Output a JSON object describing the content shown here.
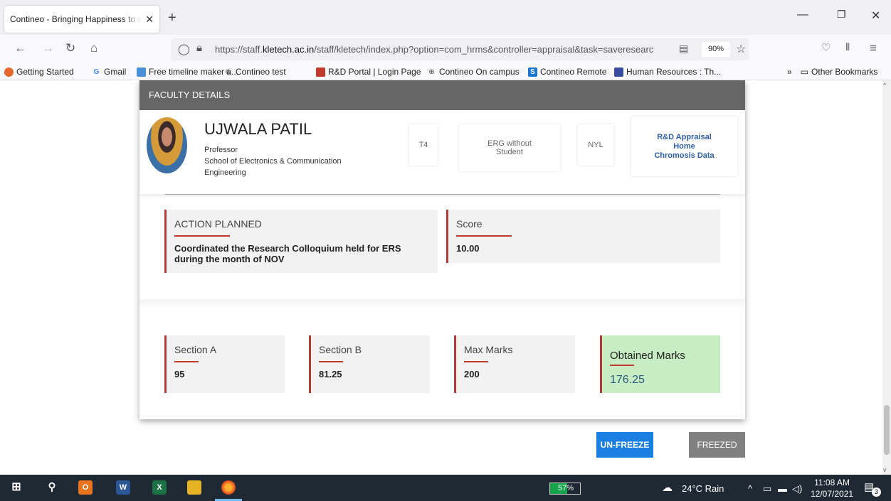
{
  "browser": {
    "tab_title": "Contineo - Bringing Happiness to w",
    "url_host": "https://staff.",
    "url_domain": "kletech.ac.in",
    "url_path": "/staff/kletech/index.php?option=com_hrms&controller=appraisal&task=saveresearc",
    "zoom": "90%",
    "bookmarks": [
      "Getting Started",
      "Gmail",
      "Free timeline maker a...",
      "Contineo test",
      "R&D Portal | Login Page",
      "Contineo On campus",
      "Contineo Remote",
      "Human Resources : Th..."
    ],
    "other_bookmarks": "Other Bookmarks"
  },
  "page": {
    "header": "FACULTY DETAILS",
    "faculty": {
      "name": "UJWALA PATIL",
      "designation": "Professor",
      "school": "School of Electronics & Communication Engineering"
    },
    "tags": {
      "grade": "T4",
      "category": "ERG without Student",
      "status": "NYL"
    },
    "links": {
      "appraisal": "R&D Appraisal",
      "home": "Home",
      "chromosis": "Chromosis Data"
    },
    "action": {
      "label": "ACTION PLANNED",
      "value": "Coordinated the Research Colloquium held for ERS during the month of NOV"
    },
    "score": {
      "label": "Score",
      "value": "10.00"
    },
    "summary": {
      "section_a_label": "Section A",
      "section_a_value": "95",
      "section_b_label": "Section B",
      "section_b_value": "81.25",
      "max_label": "Max Marks",
      "max_value": "200",
      "obtained_label": "Obtained Marks",
      "obtained_value": "176.25"
    },
    "buttons": {
      "unfreeze": "UN-FREEZE",
      "freezed": "FREEZED"
    }
  },
  "taskbar": {
    "battery": "57%",
    "battery_level": 0.57,
    "weather": "24°C Rain",
    "time": "11:08 AM",
    "date": "12/07/2021",
    "notifications": "3"
  },
  "colors": {
    "accent_red": "#b23a3a",
    "unfreeze_blue": "#1a7fe0",
    "freezed_gray": "#808080",
    "obtained_green": "#c8ecc4",
    "header_gray": "#666666"
  }
}
